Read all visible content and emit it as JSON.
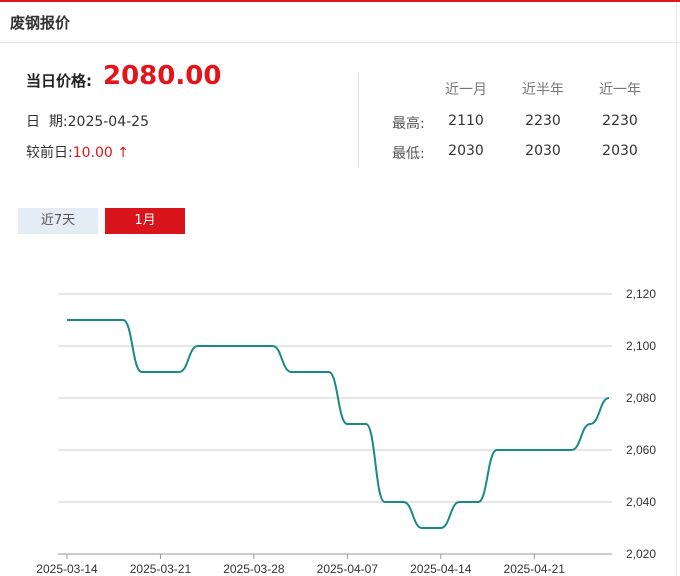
{
  "header": {
    "title": "废钢报价"
  },
  "summary": {
    "price_label": "当日价格:",
    "price": "2080.00",
    "date_label": "日  期:",
    "date": "2025-04-25",
    "change_label": "较前日:",
    "change": "10.00",
    "change_arrow": "↑"
  },
  "stats": {
    "columns": [
      "近一月",
      "近半年",
      "近一年"
    ],
    "rows": [
      {
        "label": "最高:",
        "values": [
          "2110",
          "2230",
          "2230"
        ]
      },
      {
        "label": "最低:",
        "values": [
          "2030",
          "2030",
          "2030"
        ]
      }
    ]
  },
  "tabs": [
    {
      "label": "近7天",
      "active": false
    },
    {
      "label": "1月",
      "active": true
    }
  ],
  "colors": {
    "accent": "#e3141a",
    "line": "#1a8a85",
    "grid": "#cccccc"
  },
  "chart_data": {
    "type": "line",
    "title": "",
    "xlabel": "",
    "ylabel": "",
    "ylim": [
      2020,
      2120
    ],
    "yticks": [
      2020,
      2040,
      2060,
      2080,
      2100,
      2120
    ],
    "ytick_labels": [
      "2,020",
      "2,040",
      "2,060",
      "2,080",
      "2,100",
      "2,120"
    ],
    "xtick_labels": [
      "2025-03-14",
      "2025-03-21",
      "2025-03-28",
      "2025-04-07",
      "2025-04-14",
      "2025-04-21"
    ],
    "grid": true,
    "series": [
      {
        "x": [
          "2025-03-14",
          "2025-03-17",
          "2025-03-18",
          "2025-03-19",
          "2025-03-20",
          "2025-03-21",
          "2025-03-24",
          "2025-03-25",
          "2025-03-26",
          "2025-03-27",
          "2025-03-28",
          "2025-03-31",
          "2025-04-01",
          "2025-04-02",
          "2025-04-03",
          "2025-04-07",
          "2025-04-08",
          "2025-04-09",
          "2025-04-10",
          "2025-04-11",
          "2025-04-14",
          "2025-04-15",
          "2025-04-16",
          "2025-04-17",
          "2025-04-18",
          "2025-04-21",
          "2025-04-22",
          "2025-04-23",
          "2025-04-24",
          "2025-04-25"
        ],
        "values": [
          2110,
          2110,
          2110,
          2110,
          2090,
          2090,
          2090,
          2100,
          2100,
          2100,
          2100,
          2100,
          2090,
          2090,
          2090,
          2070,
          2070,
          2040,
          2040,
          2030,
          2030,
          2040,
          2040,
          2060,
          2060,
          2060,
          2060,
          2060,
          2070,
          2080
        ]
      }
    ]
  }
}
